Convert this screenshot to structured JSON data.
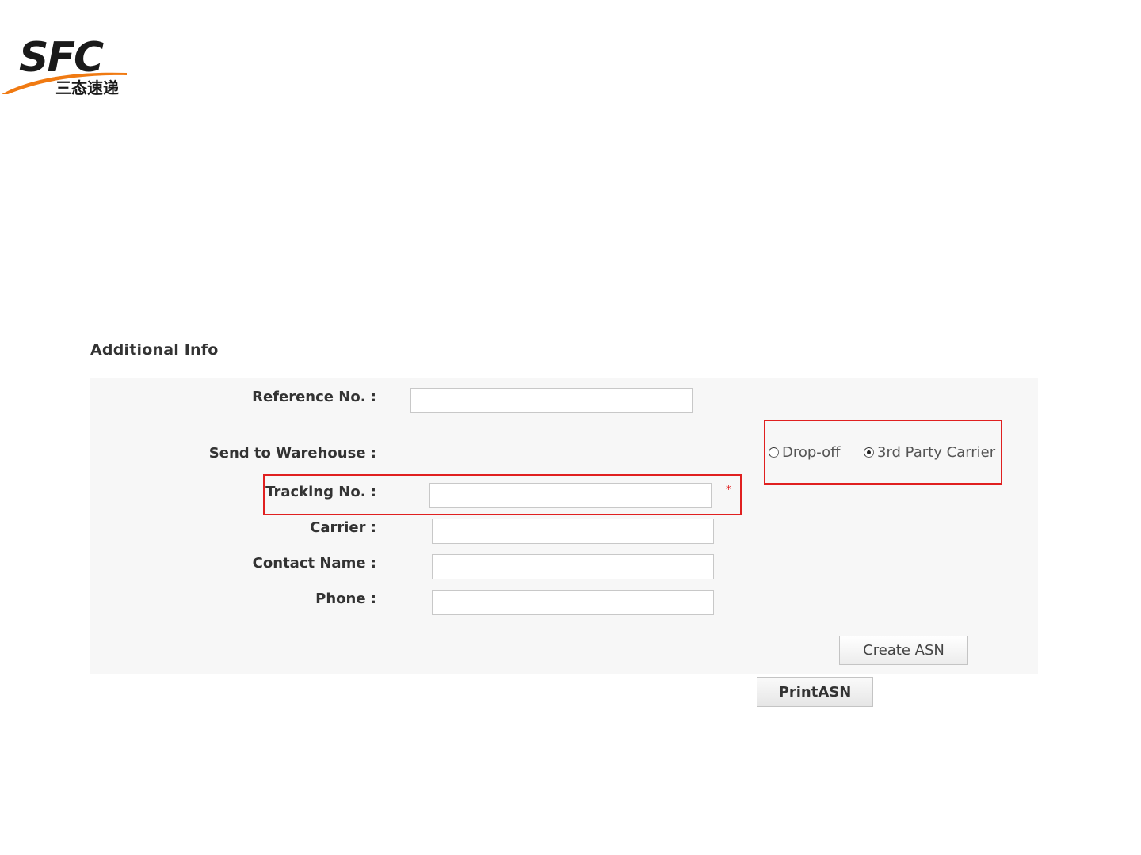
{
  "logo": {
    "brand_text": "SFC",
    "brand_subtext": "三态速递",
    "brand_colors": {
      "dark": "#1a1a1a",
      "swoosh": "#f07a12"
    }
  },
  "section": {
    "title": "Additional Info"
  },
  "form": {
    "reference_no": {
      "label": "Reference No. :",
      "value": ""
    },
    "send_to_warehouse": {
      "label": "Send to Warehouse :",
      "options": [
        {
          "label": "Drop-off",
          "checked": false
        },
        {
          "label": "3rd Party Carrier",
          "checked": true
        }
      ]
    },
    "tracking_no": {
      "label": "Tracking No. :",
      "value": "",
      "required_mark": "*"
    },
    "carrier": {
      "label": "Carrier :",
      "value": ""
    },
    "contact_name": {
      "label": "Contact Name :",
      "value": ""
    },
    "phone": {
      "label": "Phone :",
      "value": ""
    }
  },
  "buttons": {
    "create_asn": "Create ASN",
    "print_asn": "PrintASN"
  },
  "colors": {
    "highlight": "#e02020",
    "panel_background": "#f7f7f7"
  }
}
